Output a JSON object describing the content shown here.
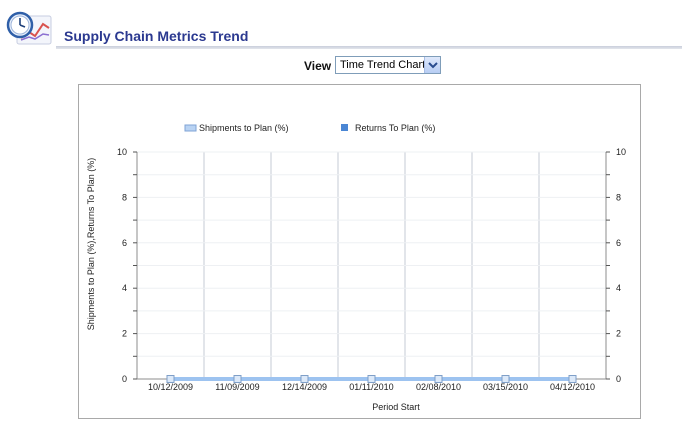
{
  "header": {
    "title": "Supply Chain Metrics Trend",
    "logo_icon": "clock-chart-icon"
  },
  "view": {
    "label": "View",
    "selected": "Time Trend Chart",
    "dropdown_icon": "chevron-down-icon"
  },
  "chart_data": {
    "type": "line",
    "categories": [
      "10/12/2009",
      "11/09/2009",
      "12/14/2009",
      "01/11/2010",
      "02/08/2010",
      "03/15/2010",
      "04/12/2010"
    ],
    "series": [
      {
        "name": "Shipments to Plan (%)",
        "values": [
          0,
          0,
          0,
          0,
          0,
          0,
          0
        ],
        "color": "#9dc3f0"
      },
      {
        "name": "Returns To Plan (%)",
        "values": [
          0,
          0,
          0,
          0,
          0,
          0,
          0
        ],
        "color": "#4a86d4"
      }
    ],
    "xlabel": "Period Start",
    "ylabel": "Shipments to Plan (%),Returns To Plan (%)",
    "ylim": [
      0,
      10
    ],
    "yticks": [
      0,
      2,
      4,
      6,
      8,
      10
    ],
    "y2ticks": [
      0,
      2,
      4,
      6,
      8,
      10
    ],
    "grid": true,
    "legend": "top"
  }
}
